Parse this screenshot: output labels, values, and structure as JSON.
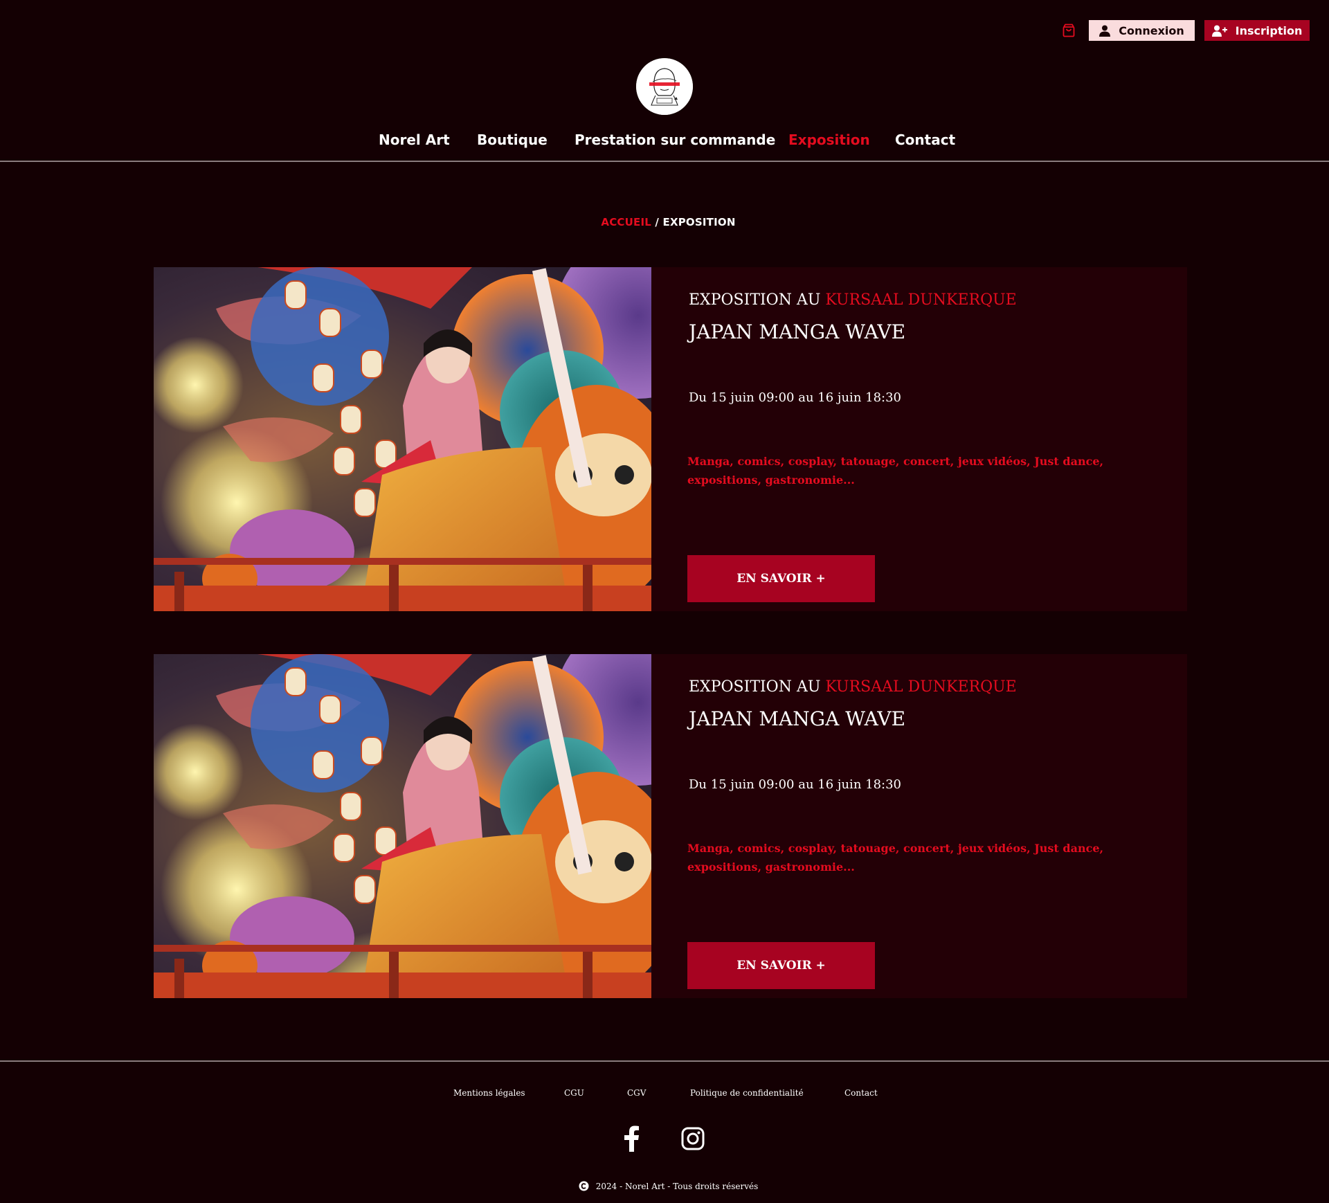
{
  "header": {
    "cart_icon": "shopping-bag-icon",
    "login_label": "Connexion",
    "signup_label": "Inscription"
  },
  "nav": [
    {
      "label": "Norel Art"
    },
    {
      "label": "Boutique"
    },
    {
      "label": "Prestation sur commande"
    },
    {
      "label": "Exposition",
      "active": true
    },
    {
      "label": "Contact"
    }
  ],
  "breadcrumb": {
    "home": "ACCUEIL",
    "separator": " / ",
    "current": "EXPOSITION"
  },
  "exhibitions": [
    {
      "kicker_prefix": "EXPOSITION AU ",
      "place": "KURSAAL DUNKERQUE",
      "title": "JAPAN MANGA WAVE",
      "dates": "Du 15 juin 09:00 au 16 juin 18:30",
      "description": "Manga, comics, cosplay, tatouage, concert, jeux vidéos, Just dance, expositions, gastronomie...",
      "cta": "EN SAVOIR +"
    },
    {
      "kicker_prefix": "EXPOSITION AU ",
      "place": "KURSAAL DUNKERQUE",
      "title": "JAPAN MANGA WAVE",
      "dates": "Du 15 juin 09:00 au 16 juin 18:30",
      "description": "Manga, comics, cosplay, tatouage, concert, jeux vidéos, Just dance, expositions, gastronomie...",
      "cta": "EN SAVOIR +"
    }
  ],
  "footer": {
    "links": [
      "Mentions légales",
      "CGU",
      "CGV",
      "Politique de confidentialité",
      "Contact"
    ],
    "social": [
      "facebook-icon",
      "instagram-icon"
    ],
    "copyright": "2024 - Norel Art - Tous droits réservés"
  },
  "colors": {
    "background": "#140003",
    "card": "#230006",
    "accent": "#e40c1f",
    "button": "#a70321",
    "login_button": "#fadcdd"
  }
}
